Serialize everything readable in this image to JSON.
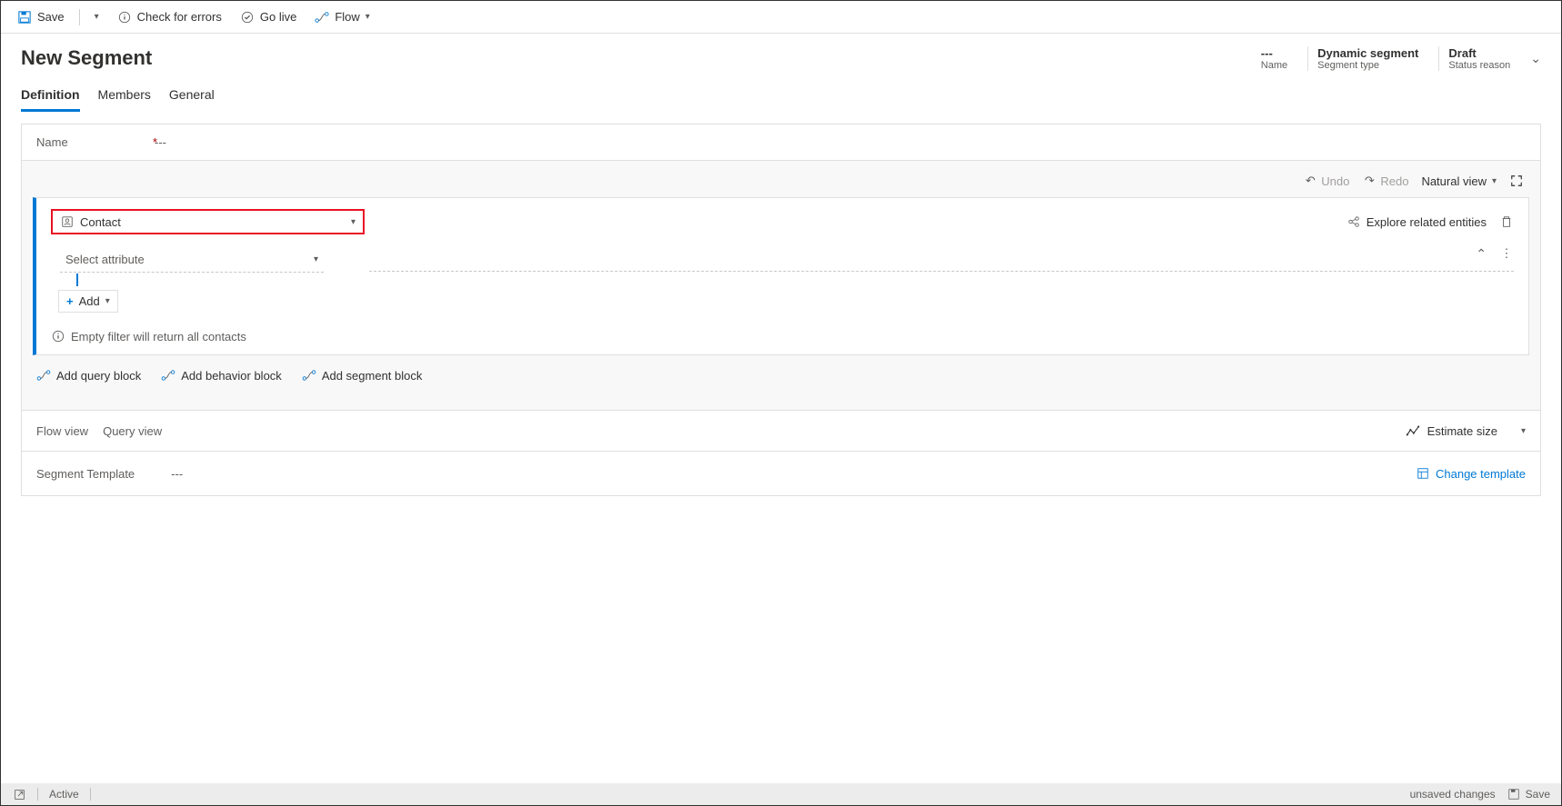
{
  "toolbar": {
    "save": "Save",
    "check": "Check for errors",
    "golive": "Go live",
    "flow": "Flow"
  },
  "header": {
    "title": "New Segment",
    "meta": [
      {
        "value": "---",
        "label": "Name"
      },
      {
        "value": "Dynamic segment",
        "label": "Segment type"
      },
      {
        "value": "Draft",
        "label": "Status reason"
      }
    ]
  },
  "tabs": {
    "definition": "Definition",
    "members": "Members",
    "general": "General"
  },
  "nameField": {
    "label": "Name",
    "value": "---"
  },
  "queryToolbar": {
    "undo": "Undo",
    "redo": "Redo",
    "view": "Natural view"
  },
  "block": {
    "entity": "Contact",
    "attribute": "Select attribute",
    "add": "Add",
    "info": "Empty filter will return all contacts",
    "explore": "Explore related entities"
  },
  "addBlocks": {
    "query": "Add query block",
    "behavior": "Add behavior block",
    "segment": "Add segment block"
  },
  "views": {
    "flow": "Flow view",
    "query": "Query view",
    "estimate": "Estimate size"
  },
  "template": {
    "label": "Segment Template",
    "value": "---",
    "change": "Change template"
  },
  "status": {
    "active": "Active",
    "unsaved": "unsaved changes",
    "save": "Save"
  }
}
